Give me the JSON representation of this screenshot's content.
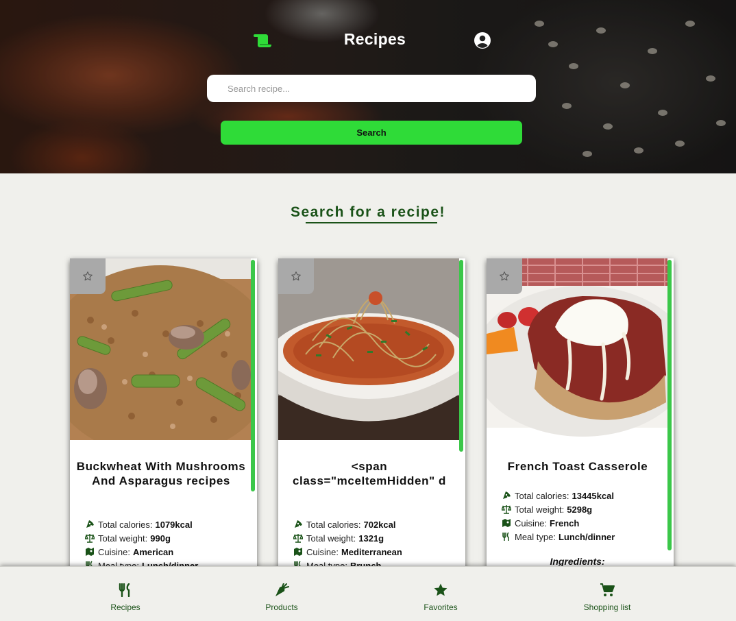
{
  "header": {
    "logo_icon": "scroll-icon",
    "title": "Recipes",
    "profile_icon": "user-circle-icon"
  },
  "search": {
    "placeholder": "Search recipe...",
    "value": "",
    "button_label": "Search"
  },
  "section": {
    "title": "Search for a recipe!"
  },
  "cards": [
    {
      "title": "Buckwheat With Mushrooms And Asparagus recipes",
      "calories_label": "Total calories:",
      "calories": "1079kcal",
      "weight_label": "Total weight:",
      "weight": "990g",
      "cuisine_label": "Cuisine:",
      "cuisine": "American",
      "meal_label": "Meal type:",
      "meal": "Lunch/dinner",
      "favorite_icon": "star-outline-icon",
      "photo": "buckwheat-asparagus-mushroom-dish"
    },
    {
      "title": "<span class=\"mceItemHidden\" d",
      "calories_label": "Total calories:",
      "calories": "702kcal",
      "weight_label": "Total weight:",
      "weight": "1321g",
      "cuisine_label": "Cuisine:",
      "cuisine": "Mediterranean",
      "meal_label": "Meal type:",
      "meal": "Brunch",
      "favorite_icon": "star-outline-icon",
      "photo": "zucchini-noodles-tomato-sauce"
    },
    {
      "title": "French Toast Casserole",
      "calories_label": "Total calories:",
      "calories": "13445kcal",
      "weight_label": "Total weight:",
      "weight": "5298g",
      "cuisine_label": "Cuisine:",
      "cuisine": "French",
      "meal_label": "Meal type:",
      "meal": "Lunch/dinner",
      "ingredients_heading": "Ingredients:",
      "favorite_icon": "star-outline-icon",
      "photo": "french-toast-casserole-with-cream"
    }
  ],
  "bottom_nav": [
    {
      "label": "Recipes",
      "icon": "utensils-icon"
    },
    {
      "label": "Products",
      "icon": "carrot-icon"
    },
    {
      "label": "Favorites",
      "icon": "star-icon"
    },
    {
      "label": "Shopping list",
      "icon": "cart-icon"
    }
  ],
  "colors": {
    "accent_green": "#2fdb38",
    "dark_green": "#1a5218",
    "background": "#f0f0ec"
  }
}
